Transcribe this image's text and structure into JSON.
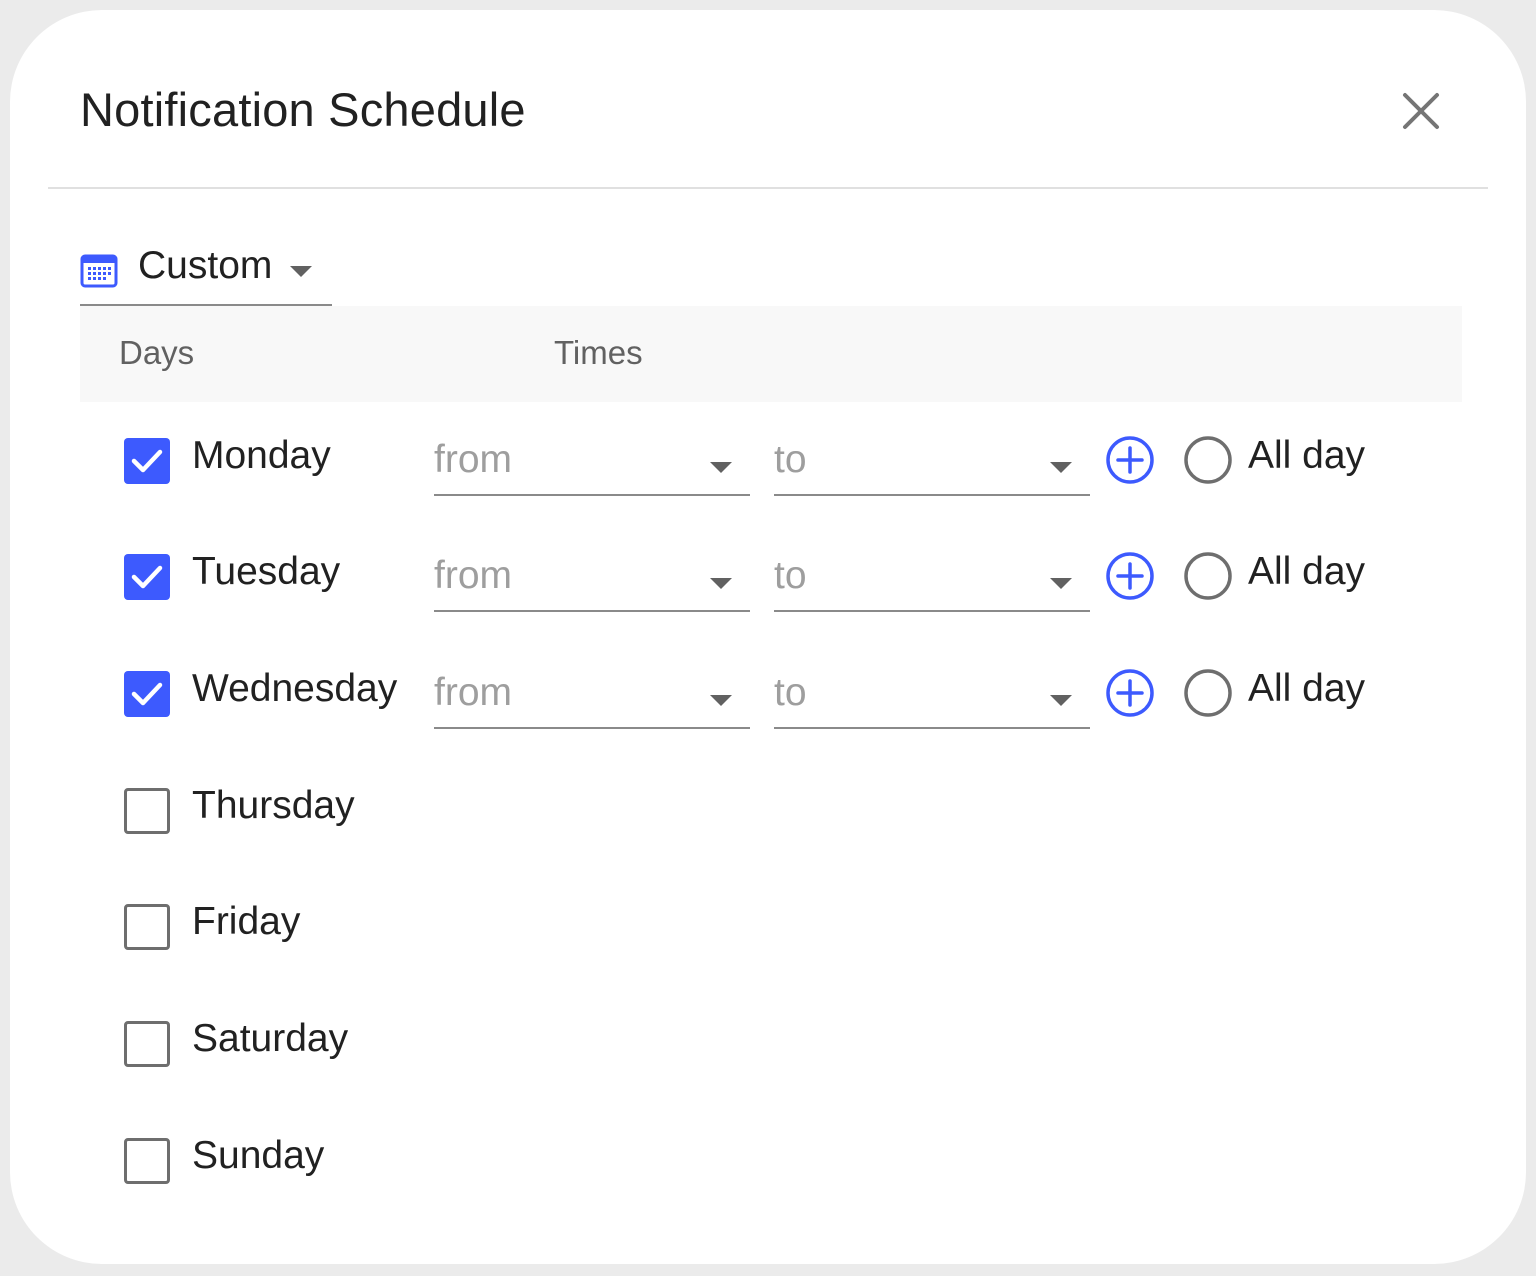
{
  "dialog": {
    "title": "Notification Schedule"
  },
  "schedule": {
    "mode_label": "Custom",
    "columns": {
      "days": "Days",
      "times": "Times"
    },
    "days": [
      {
        "label": "Monday",
        "checked": true,
        "from_placeholder": "from",
        "to_placeholder": "to",
        "all_day_label": "All day"
      },
      {
        "label": "Tuesday",
        "checked": true,
        "from_placeholder": "from",
        "to_placeholder": "to",
        "all_day_label": "All day"
      },
      {
        "label": "Wednesday",
        "checked": true,
        "from_placeholder": "from",
        "to_placeholder": "to",
        "all_day_label": "All day"
      },
      {
        "label": "Thursday",
        "checked": false
      },
      {
        "label": "Friday",
        "checked": false
      },
      {
        "label": "Saturday",
        "checked": false
      },
      {
        "label": "Sunday",
        "checked": false
      }
    ]
  },
  "icons": {
    "close": "close-icon",
    "calendar": "calendar-icon",
    "caret": "caret-down-icon",
    "add": "add-circle-icon",
    "check": "check-icon"
  },
  "colors": {
    "accent": "#3d5afe",
    "text": "#212121",
    "placeholder": "#9e9e9e",
    "header_bg": "#f8f8f8"
  }
}
